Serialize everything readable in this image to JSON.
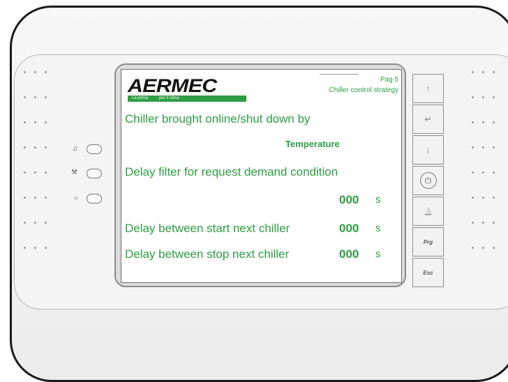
{
  "brand": {
    "logo": "AERMEC",
    "tagline_left": "La prima",
    "tagline_right": "per il clima"
  },
  "header": {
    "page": "Pag 5",
    "title": "Chiller control strategy"
  },
  "rows": {
    "brought_online_label": "Chiller brought online/shut down by",
    "brought_online_value": "Temperature",
    "delay_filter_label": "Delay filter for request demand condition",
    "delay_filter_value": "000",
    "delay_filter_unit": "s",
    "delay_start_label": "Delay between start next chiller",
    "delay_start_value": "000",
    "delay_start_unit": "s",
    "delay_stop_label": "Delay between stop next chiller",
    "delay_stop_value": "000",
    "delay_stop_unit": "s"
  },
  "keys": {
    "up": "↑",
    "enter": "↵",
    "down": "↓",
    "power": "⏻",
    "alarm": "🔔",
    "prg": "Prg",
    "esc": "Esc"
  },
  "leds": {
    "alarm_icon": "bell-icon",
    "service_icon": "wrench-icon",
    "power_icon": "circle-icon"
  },
  "colors": {
    "text_green": "#2e9e44",
    "logo_strip": "#2e9e44"
  }
}
